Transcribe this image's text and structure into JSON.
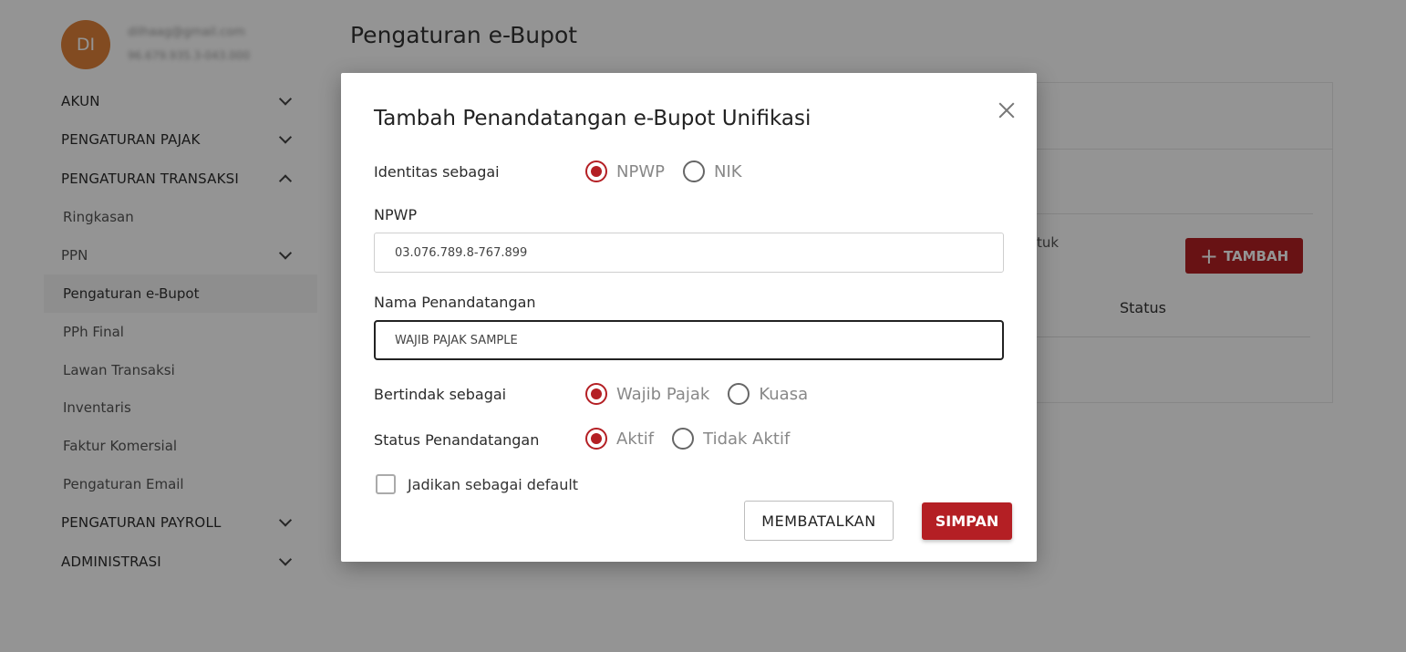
{
  "user": {
    "initials": "DI",
    "email": "dilhaag@gmail.com",
    "npwp": "96.679.935.3-043.000"
  },
  "sidebar": {
    "items": [
      {
        "label": "AKUN"
      },
      {
        "label": "PENGATURAN PAJAK"
      },
      {
        "label": "PENGATURAN TRANSAKSI"
      },
      {
        "label": "Ringkasan"
      },
      {
        "label": "PPN"
      },
      {
        "label": "Pengaturan e-Bupot"
      },
      {
        "label": "PPh Final"
      },
      {
        "label": "Lawan Transaksi"
      },
      {
        "label": "Inventaris"
      },
      {
        "label": "Faktur Komersial"
      },
      {
        "label": "Pengaturan Email"
      },
      {
        "label": "PENGATURAN PAYROLL"
      },
      {
        "label": "ADMINISTRASI"
      }
    ]
  },
  "page": {
    "title": "Pengaturan e-Bupot",
    "card": {
      "fragment_text": "tuk",
      "add_button_label": "TAMBAH",
      "status_header": "Status"
    }
  },
  "modal": {
    "title": "Tambah Penandatangan e-Bupot Unifikasi",
    "identity": {
      "label": "Identitas sebagai",
      "options": [
        "NPWP",
        "NIK"
      ],
      "selected": "NPWP"
    },
    "npwp": {
      "label": "NPWP",
      "value": "03.076.789.8-767.899"
    },
    "signer_name": {
      "label": "Nama Penandatangan",
      "value": "WAJIB PAJAK SAMPLE"
    },
    "acting_as": {
      "label": "Bertindak sebagai",
      "options": [
        "Wajib Pajak",
        "Kuasa"
      ],
      "selected": "Wajib Pajak"
    },
    "signer_status": {
      "label": "Status Penandatangan",
      "options": [
        "Aktif",
        "Tidak Aktif"
      ],
      "selected": "Aktif"
    },
    "default_checkbox": {
      "label": "Jadikan sebagai default",
      "checked": false
    },
    "cancel_label": "MEMBATALKAN",
    "save_label": "SIMPAN"
  },
  "colors": {
    "accent": "#b41f24",
    "avatar": "#e0823a"
  }
}
